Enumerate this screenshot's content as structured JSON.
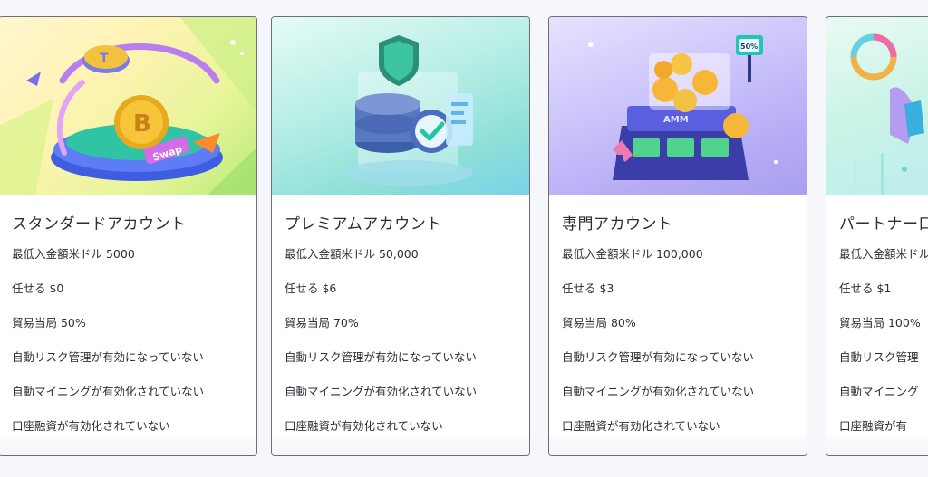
{
  "cards": [
    {
      "title": "スタンダードアカウント",
      "rows": [
        "最低入金額米ドル 5000",
        "任せる $0",
        "貿易当局 50%",
        "自動リスク管理が有効になっていない",
        "自動マイニングが有効化されていない",
        "口座融資が有効化されていない"
      ],
      "art_labels": [
        "Swap"
      ]
    },
    {
      "title": "プレミアムアカウント",
      "rows": [
        "最低入金額米ドル 50,000",
        "任せる $6",
        "貿易当局 70%",
        "自動リスク管理が有効になっていない",
        "自動マイニングが有効化されていない",
        "口座融資が有効化されていない"
      ],
      "art_labels": []
    },
    {
      "title": "専門アカウント",
      "rows": [
        "最低入金額米ドル 100,000",
        "任せる $3",
        "貿易当局 80%",
        "自動リスク管理が有効になっていない",
        "自動マイニングが有効化されていない",
        "口座融資が有効化されていない"
      ],
      "art_labels": [
        "AMM",
        "50%"
      ]
    },
    {
      "title": "パートナー口",
      "rows": [
        "最低入金額米ドル",
        "任せる $1",
        "貿易当局 100%",
        "自動リスク管理",
        "自動マイニング",
        "口座融資が有"
      ],
      "art_labels": []
    }
  ],
  "colors": {
    "card_border": "#6b6f75",
    "page_bg": "#f5f7fb",
    "text": "#2c2f35"
  }
}
